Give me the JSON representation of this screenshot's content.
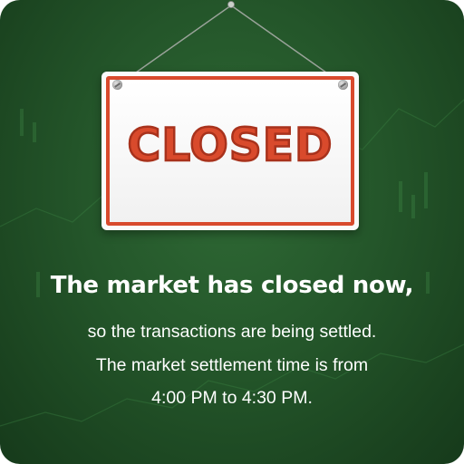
{
  "sign": {
    "word": "CLOSED",
    "icon": "hanging-sign-icon"
  },
  "message": {
    "headline": "The market has closed now,",
    "lines": [
      "so the transactions are being settled.",
      "The market settlement time is from",
      "4:00 PM to 4:30 PM."
    ]
  },
  "colors": {
    "background": "#24562a",
    "sign_accent": "#d94a2c",
    "text": "#ffffff"
  }
}
